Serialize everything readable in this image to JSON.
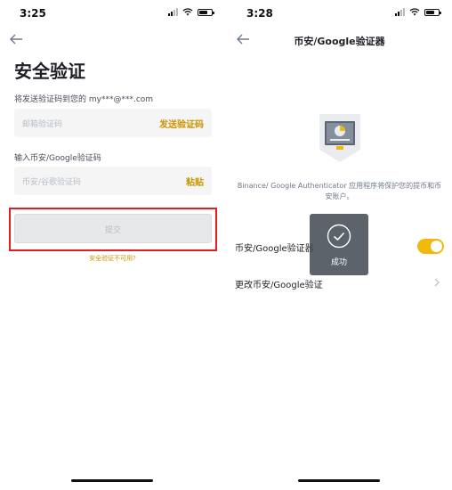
{
  "left": {
    "status": {
      "time": "3:25"
    },
    "title": "安全验证",
    "email_hint": "将发送验证码到您的 my***@***.com",
    "email_field": {
      "placeholder": "邮箱验证码",
      "action": "发送验证码"
    },
    "ga_label": "输入币安/Google验证码",
    "ga_field": {
      "placeholder": "币安/谷歌验证码",
      "action": "粘贴"
    },
    "submit_label": "提交",
    "unavailable_link": "安全验证不可用?",
    "highlight_color": "#e02020"
  },
  "right": {
    "status": {
      "time": "3:28"
    },
    "nav_title": "币安/Google验证器",
    "description": "Binance/ Google Authenticator 应用程序将保护您的提币和币安账户。",
    "toggle_row": {
      "label": "币安/Google验证器",
      "enabled": true
    },
    "change_row": {
      "label": "更改币安/Google验证"
    },
    "toast": {
      "text": "成功"
    }
  },
  "colors": {
    "accent": "#f0b90b",
    "accent_text": "#c99400",
    "toast_bg": "#474d57"
  },
  "icons": [
    "back-arrow-icon",
    "signal-icon",
    "wifi-icon",
    "battery-icon",
    "chevron-right-icon",
    "check-circle-icon",
    "authenticator-shield-icon"
  ]
}
